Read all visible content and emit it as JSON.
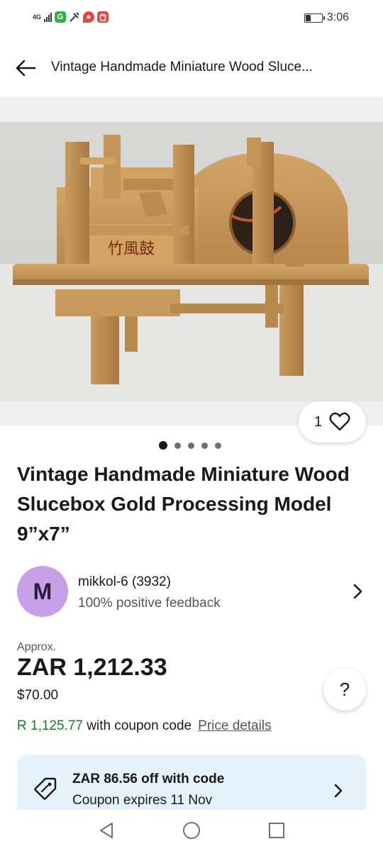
{
  "status_bar": {
    "network": "4G",
    "time": "3:06",
    "app_icons": [
      "G",
      "X",
      "P",
      "S"
    ],
    "colors": {
      "app1": "#2fb44a",
      "app3": "#e8453c",
      "app4": "#e8453c"
    }
  },
  "topbar": {
    "title": "Vintage Handmade Miniature Wood Sluce..."
  },
  "gallery": {
    "like_count": "1",
    "image_count": 5,
    "active_index": 0,
    "photo_label": "竹風鼓"
  },
  "item": {
    "title": "Vintage Handmade Miniature Wood Slucebox Gold Processing Model 9”x7”"
  },
  "seller": {
    "avatar_letter": "M",
    "name": "mikkol-6 (3932)",
    "feedback": "100% positive feedback",
    "avatar_color": "#c7a0e8"
  },
  "price": {
    "approx_label": "Approx.",
    "local": "ZAR 1,212.33",
    "usd": "$70.00",
    "help_label": "?"
  },
  "coupon_line": {
    "discounted_price": "R 1,125.77",
    "text": " with coupon code",
    "link": "Price details",
    "green_color": "#1e7a2e"
  },
  "coupon_card": {
    "title": "ZAR 86.56 off with code",
    "subtitle": "Coupon expires 11 Nov",
    "background": "#e6f2fb"
  }
}
